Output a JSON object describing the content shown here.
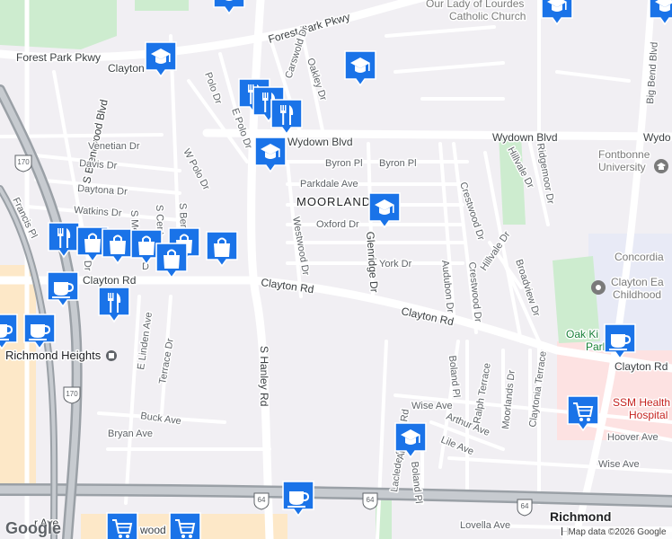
{
  "map": {
    "labels": {
      "forest_park_pkwy_top": "Forest Park Pkwy",
      "forest_park_pkwy_left": "Forest Park Pkwy",
      "clayton_top": "Clayton",
      "wydown_blvd_left": "Wydown Blvd",
      "wydown_blvd_right": "Wydown Blvd",
      "wydown_far_right": "Wydo",
      "carswold_dr": "Carswold Dr",
      "oakley_dr": "Oakley Dr",
      "polo_dr": "Polo Dr",
      "e_polo_dr": "E Polo Dr",
      "w_polo_dr": "W Polo Dr",
      "s_brentwood_blvd": "S Brentwood Blvd",
      "venetian_dr": "Venetian Dr",
      "davis_dr": "Davis Dr",
      "daytona_dr": "Daytona Dr",
      "watkins_dr": "Watkins Dr",
      "francis_pl": "Francis Pl",
      "byron_pl_1": "Byron Pl",
      "byron_pl_2": "Byron Pl",
      "parkdale_ave": "Parkdale Ave",
      "moorlands": "MOORLAND",
      "oxford_dr": "Oxford Dr",
      "york_dr": "York Dr",
      "westwood_dr": "Westwood Dr",
      "glenridge_dr": "Glenridge Dr",
      "audubon_dr": "Audubon Dr",
      "crestwood_dr_1": "Crestwood Dr",
      "crestwood_dr_2": "Crestwood Dr",
      "hillvale_dr_1": "Hillvale Dr",
      "hillvale_dr_2": "Hillvale Dr",
      "ridgemoor_dr": "Ridgemoor Dr",
      "broadview_dr": "Broadview Dr",
      "big_bend_blvd": "Big Bend Blvd",
      "clayton_rd_left": "Clayton Rd",
      "clayton_rd_mid": "Clayton Rd",
      "clayton_rd_center": "Clayton Rd",
      "clayton_rd_right": "Clayton Rd",
      "s_hanley_rd": "S Hanley Rd",
      "e_linden_ave": "E Linden Ave",
      "terrace_dr": "Terrace Dr",
      "buck_ave": "Buck Ave",
      "bryan_ave": "Bryan Ave",
      "boland_pl_1": "Boland Pl",
      "boland_pl_2": "Boland Pl",
      "ralph_terrace": "Ralph Terrace",
      "moorlands_dr": "Moorlands Dr",
      "claytonia_terrace": "Claytonia Terrace",
      "wise_ave_1": "Wise Ave",
      "wise_ave_2": "Wise Ave",
      "arthur_ave": "Arthur Ave",
      "lile_ave": "Lile Ave",
      "hoover_ave": "Hoover Ave",
      "lovella_ave": "Lovella Ave",
      "laclede_station_rd": "Laclede Station Rd",
      "arch_t": "Arch T",
      "s_cent": "S Cent",
      "s_mer": "S Mer",
      "s_ber": "S Ber",
      "dr_small": "Dr",
      "d_small": "D",
      "richmond_heights": "Richmond Heights",
      "richmond": "Richmond",
      "h_small": "H",
      "our_lady_1": "Our Lady of Lourdes",
      "our_lady_2": "Catholic Church",
      "fontbonne_1": "Fontbonne",
      "fontbonne_2": "University",
      "concordia": "Concordia",
      "clayton_early_1": "Clayton Ea",
      "clayton_early_2": "Childhood",
      "oak_knoll_1": "Oak Ki",
      "oak_knoll_2": "Park",
      "ssm_health_1": "SSM Health",
      "ssm_health_2": "Hospital",
      "wood_small": "wood",
      "r_ave_small": "r Ave",
      "i64_1": "64",
      "i64_2": "64",
      "i64_3": "64",
      "i170_1": "170",
      "i170_2": "170"
    },
    "icons": {
      "school": "graduation-cap-icon",
      "restaurant": "fork-knife-icon",
      "shopping": "shopping-bag-icon",
      "cafe": "coffee-cup-icon",
      "grocery": "shopping-cart-icon"
    },
    "colors": {
      "background": "#f1eff3",
      "pin": "#1a73e8",
      "park": "#cdeccf",
      "highway": "#9aa0a6",
      "hospital": "#c5221f"
    },
    "logo": "Google",
    "attribution": "Map data ©2026 Google"
  }
}
